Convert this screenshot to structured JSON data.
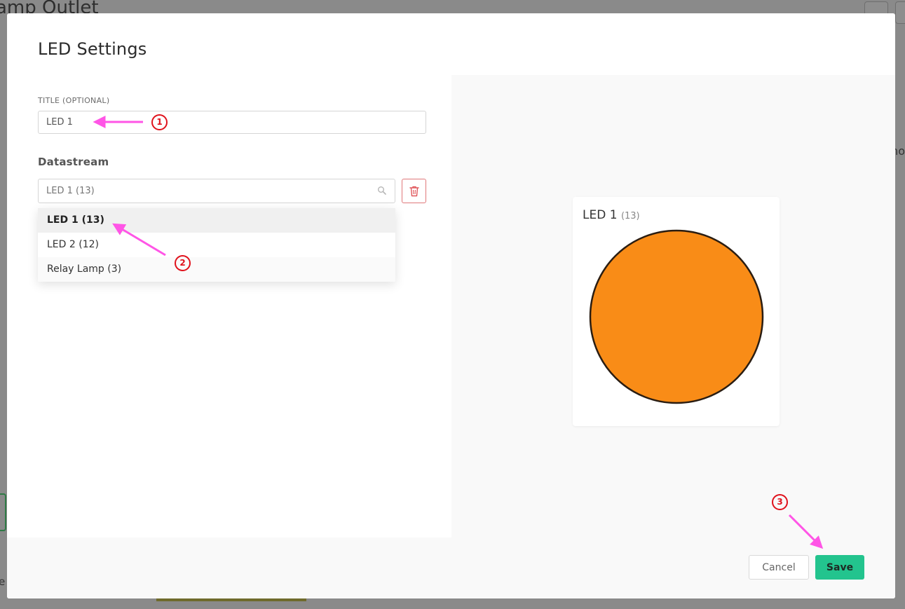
{
  "background": {
    "title": "amp Outlet",
    "side_text": "no",
    "edge_text": "e"
  },
  "modal": {
    "title": "LED Settings",
    "title_field": {
      "label": "TITLE (OPTIONAL)",
      "value": "LED 1"
    },
    "datastream": {
      "label": "Datastream",
      "value": "LED 1 (13)",
      "options": [
        {
          "label": "LED 1 (13)",
          "selected": true
        },
        {
          "label": "LED 2 (12)",
          "selected": false
        },
        {
          "label": "Relay Lamp (3)",
          "selected": false
        }
      ]
    },
    "preview": {
      "title": "LED 1",
      "pin": "(13)",
      "led_color": "#f98c17",
      "led_border_color": "#2a1d12"
    },
    "footer": {
      "cancel_label": "Cancel",
      "save_label": "Save"
    }
  },
  "annotations": [
    {
      "number": "1"
    },
    {
      "number": "2"
    },
    {
      "number": "3"
    }
  ],
  "colors": {
    "accent_green": "#23c48e",
    "annotation_arrow": "#ff55e6",
    "annotation_number": "#e0121c",
    "delete_red": "#e0787a"
  }
}
